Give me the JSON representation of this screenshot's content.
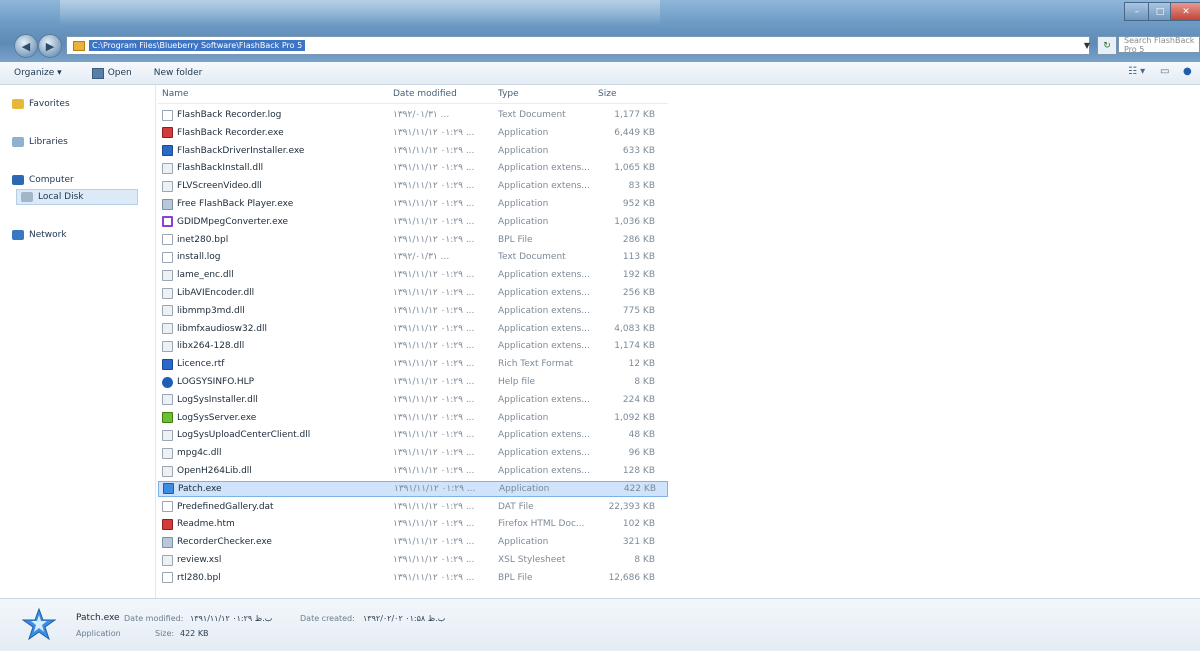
{
  "address": {
    "path": "C:\\Program Files\\Blueberry Software\\FlashBack Pro 5",
    "search_placeholder": "Search FlashBack Pro 5"
  },
  "toolbar": {
    "organize": "Organize ▾",
    "open": "Open",
    "new_folder": "New folder"
  },
  "nav": {
    "favorites": "Favorites",
    "libraries": "Libraries",
    "computer": "Computer",
    "local_disk": "Local Disk",
    "network": "Network"
  },
  "columns": {
    "name": "Name",
    "date": "Date modified",
    "type": "Type",
    "size": "Size"
  },
  "files": [
    {
      "name": "FlashBack Recorder.log",
      "date": "۱۳۹۲/۰۱/۳۱ ...",
      "type": "Text Document",
      "size": "1,177 KB",
      "icon": "doc-icon"
    },
    {
      "name": "FlashBack Recorder.exe",
      "date": "۱۳۹۱/۱۱/۱۲ ۰۱:۲۹ ...",
      "type": "Application",
      "size": "6,449 KB",
      "icon": "exe-red-icon"
    },
    {
      "name": "FlashBackDriverInstaller.exe",
      "date": "۱۳۹۱/۱۱/۱۲ ۰۱:۲۹ ...",
      "type": "Application",
      "size": "633 KB",
      "icon": "installer-icon"
    },
    {
      "name": "FlashBackInstall.dll",
      "date": "۱۳۹۱/۱۱/۱۲ ۰۱:۲۹ ...",
      "type": "Application extens...",
      "size": "1,065 KB",
      "icon": "dll-icon"
    },
    {
      "name": "FLVScreenVideo.dll",
      "date": "۱۳۹۱/۱۱/۱۲ ۰۱:۲۹ ...",
      "type": "Application extens...",
      "size": "83 KB",
      "icon": "dll-icon"
    },
    {
      "name": "Free FlashBack Player.exe",
      "date": "۱۳۹۱/۱۱/۱۲ ۰۱:۲۹ ...",
      "type": "Application",
      "size": "952 KB",
      "icon": "player-icon"
    },
    {
      "name": "GDIDMpegConverter.exe",
      "date": "۱۳۹۱/۱۱/۱۲ ۰۱:۲۹ ...",
      "type": "Application",
      "size": "1,036 KB",
      "icon": "converter-icon"
    },
    {
      "name": "inet280.bpl",
      "date": "۱۳۹۱/۱۱/۱۲ ۰۱:۲۹ ...",
      "type": "BPL File",
      "size": "286 KB",
      "icon": "doc-icon"
    },
    {
      "name": "install.log",
      "date": "۱۳۹۲/۰۱/۳۱ ...",
      "type": "Text Document",
      "size": "113 KB",
      "icon": "doc-icon"
    },
    {
      "name": "lame_enc.dll",
      "date": "۱۳۹۱/۱۱/۱۲ ۰۱:۲۹ ...",
      "type": "Application extens...",
      "size": "192 KB",
      "icon": "dll-icon"
    },
    {
      "name": "LibAVIEncoder.dll",
      "date": "۱۳۹۱/۱۱/۱۲ ۰۱:۲۹ ...",
      "type": "Application extens...",
      "size": "256 KB",
      "icon": "dll-icon"
    },
    {
      "name": "libmmp3md.dll",
      "date": "۱۳۹۱/۱۱/۱۲ ۰۱:۲۹ ...",
      "type": "Application extens...",
      "size": "775 KB",
      "icon": "dll-icon"
    },
    {
      "name": "libmfxaudiosw32.dll",
      "date": "۱۳۹۱/۱۱/۱۲ ۰۱:۲۹ ...",
      "type": "Application extens...",
      "size": "4,083 KB",
      "icon": "dll-icon"
    },
    {
      "name": "libx264-128.dll",
      "date": "۱۳۹۱/۱۱/۱۲ ۰۱:۲۹ ...",
      "type": "Application extens...",
      "size": "1,174 KB",
      "icon": "dll-icon"
    },
    {
      "name": "Licence.rtf",
      "date": "۱۳۹۱/۱۱/۱۲ ۰۱:۲۹ ...",
      "type": "Rich Text Format",
      "size": "12 KB",
      "icon": "rtf-icon"
    },
    {
      "name": "LOGSYSINFO.HLP",
      "date": "۱۳۹۱/۱۱/۱۲ ۰۱:۲۹ ...",
      "type": "Help file",
      "size": "8 KB",
      "icon": "help-icon"
    },
    {
      "name": "LogSysInstaller.dll",
      "date": "۱۳۹۱/۱۱/۱۲ ۰۱:۲۹ ...",
      "type": "Application extens...",
      "size": "224 KB",
      "icon": "dll-icon"
    },
    {
      "name": "LogSysServer.exe",
      "date": "۱۳۹۱/۱۱/۱۲ ۰۱:۲۹ ...",
      "type": "Application",
      "size": "1,092 KB",
      "icon": "server-icon"
    },
    {
      "name": "LogSysUploadCenterClient.dll",
      "date": "۱۳۹۱/۱۱/۱۲ ۰۱:۲۹ ...",
      "type": "Application extens...",
      "size": "48 KB",
      "icon": "dll-icon"
    },
    {
      "name": "mpg4c.dll",
      "date": "۱۳۹۱/۱۱/۱۲ ۰۱:۲۹ ...",
      "type": "Application extens...",
      "size": "96 KB",
      "icon": "dll-icon"
    },
    {
      "name": "OpenH264Lib.dll",
      "date": "۱۳۹۱/۱۱/۱۲ ۰۱:۲۹ ...",
      "type": "Application extens...",
      "size": "128 KB",
      "icon": "dll-icon"
    },
    {
      "name": "Patch.exe",
      "date": "۱۳۹۱/۱۱/۱۲ ۰۱:۲۹ ...",
      "type": "Application",
      "size": "422 KB",
      "icon": "star-icon",
      "selected": true
    },
    {
      "name": "PredefinedGallery.dat",
      "date": "۱۳۹۱/۱۱/۱۲ ۰۱:۲۹ ...",
      "type": "DAT File",
      "size": "22,393 KB",
      "icon": "doc-icon"
    },
    {
      "name": "Readme.htm",
      "date": "۱۳۹۱/۱۱/۱۲ ۰۱:۲۹ ...",
      "type": "Firefox HTML Doc...",
      "size": "102 KB",
      "icon": "html-icon"
    },
    {
      "name": "RecorderChecker.exe",
      "date": "۱۳۹۱/۱۱/۱۲ ۰۱:۲۹ ...",
      "type": "Application",
      "size": "321 KB",
      "icon": "exe-icon"
    },
    {
      "name": "review.xsl",
      "date": "۱۳۹۱/۱۱/۱۲ ۰۱:۲۹ ...",
      "type": "XSL Stylesheet",
      "size": "8 KB",
      "icon": "xsl-icon"
    },
    {
      "name": "rtl280.bpl",
      "date": "۱۳۹۱/۱۱/۱۲ ۰۱:۲۹ ...",
      "type": "BPL File",
      "size": "12,686 KB",
      "icon": "doc-icon"
    }
  ],
  "details": {
    "name": "Patch.exe",
    "type": "Application",
    "modified_label": "Date modified:",
    "modified_value": "۱۳۹۱/۱۱/۱۲ ب.ظ ۰۱:۲۹",
    "size_label": "Size:",
    "size_value": "422 KB",
    "created_label": "Date created:",
    "created_value": "۱۳۹۲/۰۲/۰۲ ب.ظ ۰۱:۵۸"
  }
}
